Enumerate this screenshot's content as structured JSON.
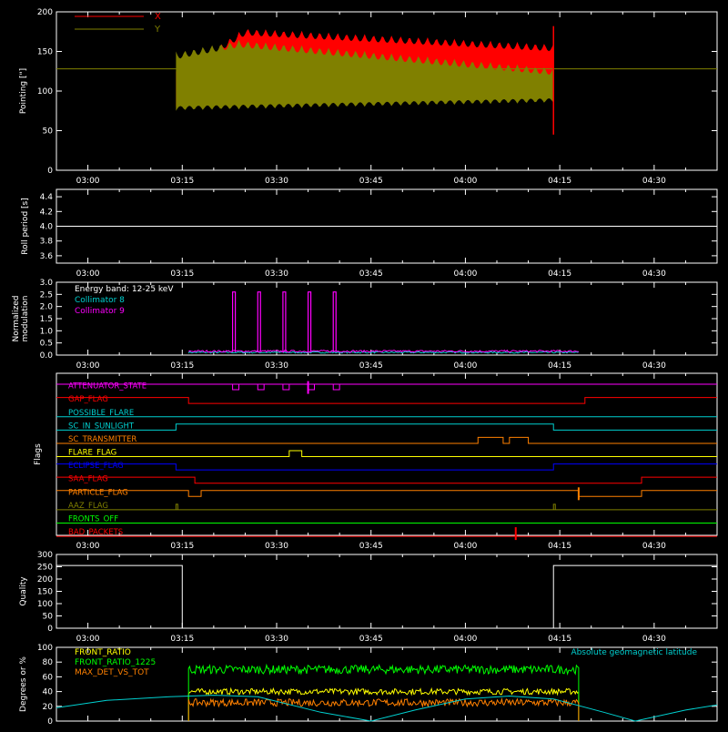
{
  "colors": {
    "background": "#000000",
    "axes": "#ffffff",
    "red": "#ff0000",
    "olive": "#808000",
    "cyan": "#00d0d0",
    "magenta": "#ff00ff",
    "orange": "#ff8000",
    "yellow": "#ffff00",
    "green": "#00ff00",
    "blue": "#0000ff",
    "darkorange": "#ff6000"
  },
  "time_axis": {
    "start": "02:55",
    "end": "04:40",
    "ticks": [
      "03:00",
      "03:15",
      "03:30",
      "03:45",
      "04:00",
      "04:15",
      "04:30"
    ]
  },
  "chart_data": [
    {
      "id": "pointing",
      "type": "area",
      "ylabel": "Pointing [\"]",
      "ylim": [
        0,
        200
      ],
      "yticks": [
        0,
        50,
        100,
        150,
        200
      ],
      "legend": {
        "placement": "top-left"
      },
      "series": [
        {
          "name": "X",
          "color": "#ff0000",
          "data_start": "03:14",
          "data_end": "04:14",
          "upper_start": 125,
          "upper_peak": 180,
          "upper_peak_time": "03:25",
          "upper_end": 160,
          "lower_start": 80,
          "lower_end": 110
        },
        {
          "name": "Y",
          "color": "#808000",
          "data_start": "03:14",
          "data_end": "04:14",
          "upper_start": 150,
          "upper_peak": 165,
          "upper_peak_time": "03:24",
          "upper_end": 130,
          "lower_start": 75,
          "lower_end": 85
        }
      ],
      "reference_level": 128
    },
    {
      "id": "roll_period",
      "type": "line",
      "ylabel": "Roll period [s]",
      "ylim": [
        3.5,
        4.5
      ],
      "yticks": [
        "3.6",
        "3.8",
        "4.0",
        "4.2",
        "4.4"
      ],
      "series": [
        {
          "name": "",
          "value": 4.0,
          "color": "#ffffff"
        }
      ]
    },
    {
      "id": "modulation",
      "type": "line",
      "ylabel": "Normalized modulation",
      "ylim": [
        0,
        3.0
      ],
      "yticks": [
        "0.0",
        "0.5",
        "1.0",
        "1.5",
        "2.0",
        "2.5",
        "3.0"
      ],
      "legend_title": "Energy band: 12-25 keV",
      "series": [
        {
          "name": "Collimator 8",
          "color": "#00d0d0",
          "baseline": 0.08,
          "start": "03:16",
          "end": "04:18"
        },
        {
          "name": "Collimator 9",
          "color": "#ff00ff",
          "baseline": 0.12,
          "start": "03:16",
          "end": "04:18",
          "spikes": [
            "03:23",
            "03:27",
            "03:31",
            "03:35",
            "03:39"
          ],
          "spike_value": 2.6
        }
      ]
    },
    {
      "id": "flags",
      "type": "step",
      "ylabel": "Flags",
      "rows": [
        {
          "name": "ATTENUATOR_STATE",
          "color": "#ff00ff",
          "pulses": [
            [
              "03:23",
              "03:24"
            ],
            [
              "03:27",
              "03:28"
            ],
            [
              "03:31",
              "03:32"
            ],
            [
              "03:35",
              "03:36"
            ],
            [
              "03:39",
              "03:40"
            ]
          ],
          "pulse_dir": "down",
          "spike": "03:35"
        },
        {
          "name": "GAP_FLAG",
          "color": "#ff0000",
          "segments": [
            [
              "02:55",
              "03:16",
              "high"
            ],
            [
              "03:16",
              "04:19",
              "low"
            ],
            [
              "04:19",
              "04:40",
              "high"
            ]
          ]
        },
        {
          "name": "POSSIBLE_FLARE",
          "color": "#00d0d0",
          "segments": [
            [
              "02:55",
              "04:40",
              "low"
            ]
          ]
        },
        {
          "name": "SC_IN_SUNLIGHT",
          "color": "#00d0d0",
          "segments": [
            [
              "02:55",
              "03:14",
              "low"
            ],
            [
              "03:14",
              "04:14",
              "high"
            ],
            [
              "04:14",
              "04:40",
              "low"
            ]
          ]
        },
        {
          "name": "SC_TRANSMITTER",
          "color": "#ff8000",
          "segments": [
            [
              "02:55",
              "04:02",
              "low"
            ],
            [
              "04:02",
              "04:06",
              "high"
            ],
            [
              "04:06",
              "04:07",
              "low"
            ],
            [
              "04:07",
              "04:10",
              "high"
            ],
            [
              "04:10",
              "04:40",
              "low"
            ]
          ]
        },
        {
          "name": "FLARE_FLAG",
          "color": "#ffff00",
          "segments": [
            [
              "02:55",
              "03:32",
              "low"
            ],
            [
              "03:32",
              "03:34",
              "high"
            ],
            [
              "03:34",
              "04:40",
              "low"
            ]
          ]
        },
        {
          "name": "ECLIPSE_FLAG",
          "color": "#0000ff",
          "segments": [
            [
              "02:55",
              "03:14",
              "high"
            ],
            [
              "03:14",
              "04:14",
              "low"
            ],
            [
              "04:14",
              "04:40",
              "high"
            ]
          ]
        },
        {
          "name": "SAA_FLAG",
          "color": "#ff0000",
          "segments": [
            [
              "02:55",
              "03:17",
              "high"
            ],
            [
              "03:17",
              "04:28",
              "low"
            ],
            [
              "04:28",
              "04:40",
              "high"
            ]
          ]
        },
        {
          "name": "PARTICLE_FLAG",
          "color": "#ff8000",
          "segments": [
            [
              "02:55",
              "03:16",
              "high"
            ],
            [
              "03:16",
              "03:18",
              "low"
            ],
            [
              "03:18",
              "04:18",
              "high"
            ],
            [
              "04:18",
              "04:28",
              "low"
            ],
            [
              "04:28",
              "04:40",
              "high"
            ]
          ],
          "spike": "04:18"
        },
        {
          "name": "AAZ_FLAG",
          "color": "#808000",
          "segments": [
            [
              "02:55",
              "04:40",
              "low"
            ]
          ],
          "pulses": [
            [
              "03:14",
              "03:14"
            ],
            [
              "04:14",
              "04:14"
            ]
          ],
          "pulse_dir": "up"
        },
        {
          "name": "FRONTS_OFF",
          "color": "#00ff00",
          "segments": [
            [
              "02:55",
              "04:40",
              "low"
            ]
          ]
        },
        {
          "name": "BAD_PACKETS",
          "color": "#ff0000",
          "segments": [
            [
              "02:55",
              "04:40",
              "low"
            ]
          ],
          "spike": "04:08"
        }
      ]
    },
    {
      "id": "quality",
      "type": "line",
      "ylabel": "Quality",
      "ylim": [
        0,
        300
      ],
      "yticks": [
        "0",
        "50",
        "100",
        "150",
        "200",
        "250",
        "300"
      ],
      "series": [
        {
          "name": "",
          "color": "#ffffff",
          "segments": [
            [
              "02:55",
              "03:15",
              255
            ],
            [
              "03:15",
              "04:14",
              0
            ],
            [
              "04:14",
              "04:40",
              255
            ]
          ]
        }
      ]
    },
    {
      "id": "ratios",
      "type": "line",
      "ylabel": "Degrees or %",
      "ylim": [
        0,
        100
      ],
      "yticks": [
        "0",
        "20",
        "40",
        "60",
        "80",
        "100"
      ],
      "right_label": "Absolute geomagnetic latitude",
      "series": [
        {
          "name": "FRONT_RATIO",
          "color": "#ffff00",
          "start": "03:16",
          "end": "04:18",
          "level": 40
        },
        {
          "name": "FRONT_RATIO_1225",
          "color": "#00ff00",
          "start": "03:16",
          "end": "04:18",
          "level": 70
        },
        {
          "name": "MAX_DET_VS_TOT",
          "color": "#ff8000",
          "start": "03:16",
          "end": "04:18",
          "level": 25
        },
        {
          "name": "Absolute geomagnetic latitude",
          "color": "#00d0d0",
          "points": [
            [
              "02:55",
              18
            ],
            [
              "03:03",
              28
            ],
            [
              "03:13",
              33
            ],
            [
              "03:20",
              35
            ],
            [
              "03:27",
              33
            ],
            [
              "03:37",
              12
            ],
            [
              "03:45",
              0
            ],
            [
              "03:52",
              15
            ],
            [
              "04:00",
              30
            ],
            [
              "04:07",
              34
            ],
            [
              "04:14",
              30
            ],
            [
              "04:22",
              12
            ],
            [
              "04:27",
              0
            ],
            [
              "04:35",
              15
            ],
            [
              "04:40",
              22
            ]
          ]
        }
      ]
    }
  ]
}
